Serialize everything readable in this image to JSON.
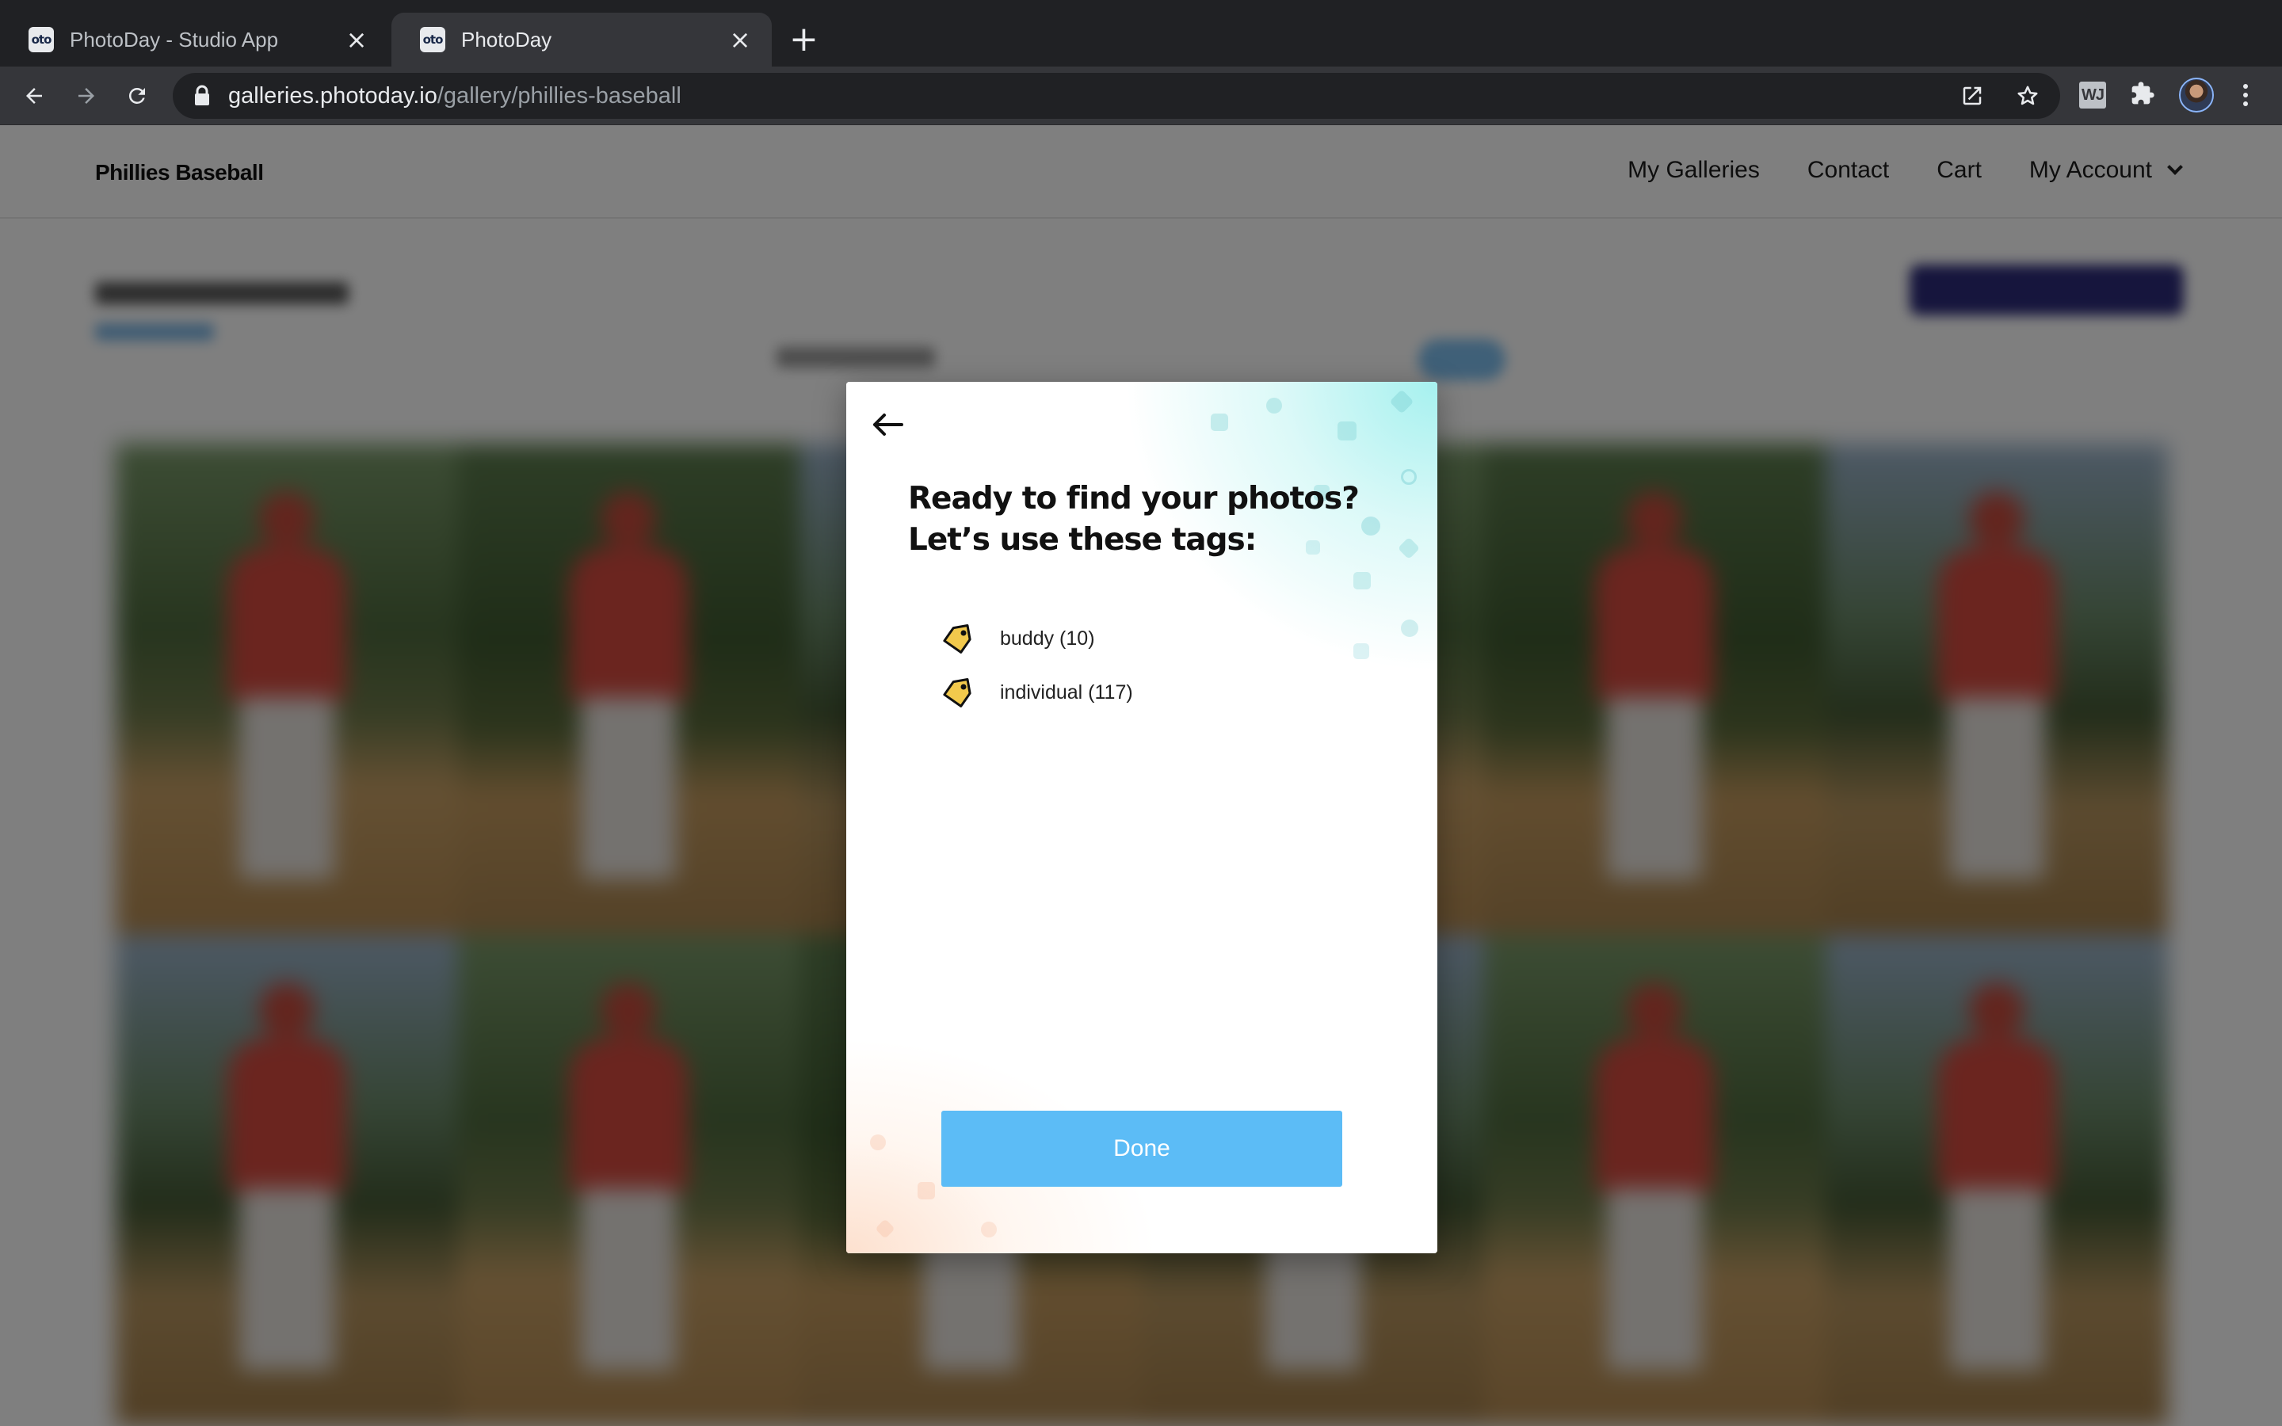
{
  "browser": {
    "tabs": [
      {
        "title": "PhotoDay - Studio App",
        "favicon_text": "oto",
        "active": false
      },
      {
        "title": "PhotoDay",
        "favicon_text": "oto",
        "active": true
      }
    ],
    "new_tab_icon": "plus-icon",
    "url_host": "galleries.photoday.io",
    "url_path": "/gallery/phillies-baseball",
    "extension_badge": "WJ",
    "icons": [
      "back-arrow-icon",
      "forward-arrow-icon",
      "reload-icon",
      "lock-icon",
      "open-in-new-window-icon",
      "star-icon",
      "puzzle-icon",
      "profile-avatar",
      "kebab-menu-icon"
    ]
  },
  "site": {
    "brand": "Phillies Baseball",
    "nav": {
      "galleries": "My Galleries",
      "contact": "Contact",
      "cart": "Cart",
      "account": "My Account"
    }
  },
  "modal": {
    "title_line1": "Ready to find your photos?",
    "title_line2": "Let’s use these tags:",
    "tags": [
      {
        "label": "buddy (10)",
        "icon": "tag-icon"
      },
      {
        "label": "individual (117)",
        "icon": "tag-icon"
      }
    ],
    "done_label": "Done",
    "accent_color": "#5cbcf6",
    "tag_color": "#f2c94c"
  }
}
